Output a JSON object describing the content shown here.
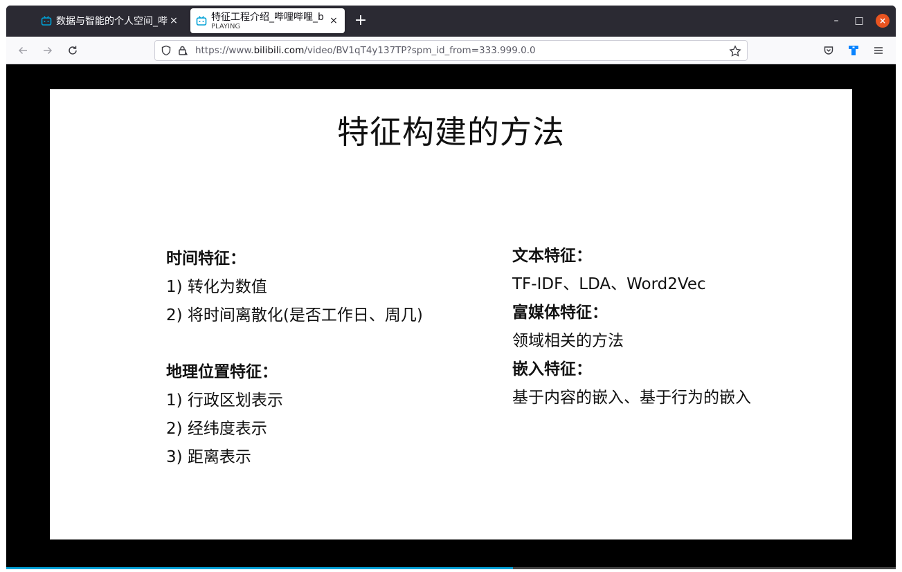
{
  "browser": {
    "tabs": [
      {
        "title": "数据与智能的个人空间_哔",
        "subtitle": "",
        "active": false
      },
      {
        "title": "特征工程介绍_哔哩哔哩_b",
        "subtitle": "PLAYING",
        "active": true
      }
    ],
    "new_tab_label": "+",
    "tab_close_label": "×",
    "window_controls": {
      "minimize": "–",
      "maximize": "□",
      "close": "×"
    },
    "url": {
      "prefix": "https://www.",
      "domain": "bilibili.com",
      "path": "/video/BV1qT4y137TP?spm_id_from=333.999.0.0"
    },
    "accent_color": "#00a1d6",
    "close_button_color": "#e95420"
  },
  "slide": {
    "title": "特征构建的方法",
    "left_column": [
      {
        "text": "时间特征：",
        "type": "heading"
      },
      {
        "text": "1) 转化为数值",
        "type": "item"
      },
      {
        "text": "2) 将时间离散化(是否工作日、周几)",
        "type": "item"
      },
      {
        "text": "",
        "type": "gap"
      },
      {
        "text": "地理位置特征：",
        "type": "heading"
      },
      {
        "text": "1) 行政区划表示",
        "type": "item"
      },
      {
        "text": "2) 经纬度表示",
        "type": "item"
      },
      {
        "text": "3) 距离表示",
        "type": "item"
      }
    ],
    "right_column": [
      {
        "text": "文本特征：",
        "type": "heading"
      },
      {
        "text": "TF-IDF、LDA、Word2Vec",
        "type": "item"
      },
      {
        "text": "富媒体特征：",
        "type": "heading"
      },
      {
        "text": "领域相关的方法",
        "type": "item"
      },
      {
        "text": "嵌入特征：",
        "type": "heading"
      },
      {
        "text": "基于内容的嵌入、基于行为的嵌入",
        "type": "item"
      }
    ]
  },
  "player": {
    "progress": 0.57
  }
}
